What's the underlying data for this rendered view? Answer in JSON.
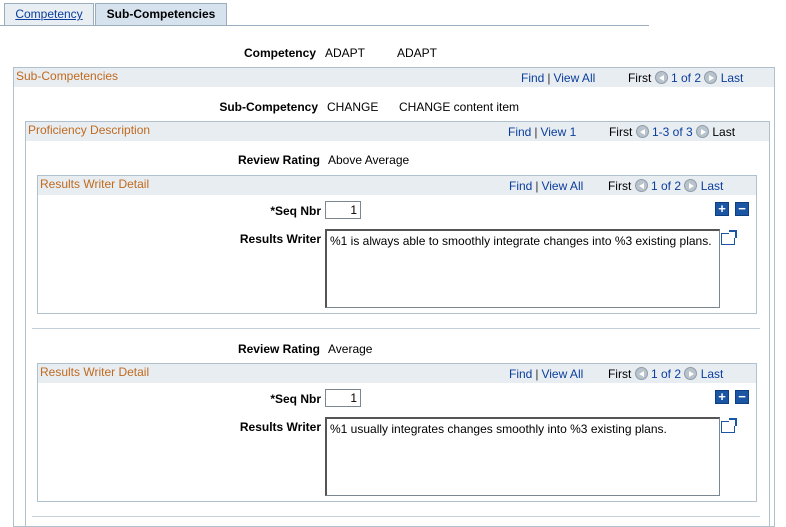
{
  "tabs": [
    {
      "label": "Competency",
      "active": false
    },
    {
      "label": "Sub-Competencies",
      "active": true
    }
  ],
  "competency": {
    "label": "Competency",
    "code": "ADAPT",
    "description": "ADAPT"
  },
  "sub_competencies": {
    "title": "Sub-Competencies",
    "nav": {
      "find": "Find",
      "sep": "|",
      "view": "View All",
      "first": "First",
      "count": "1 of 2",
      "last": "Last"
    },
    "sub_competency": {
      "label": "Sub-Competency",
      "code": "CHANGE",
      "description": "CHANGE content item"
    }
  },
  "proficiency": {
    "title": "Proficiency Description",
    "nav": {
      "find": "Find",
      "sep": "|",
      "view": "View 1",
      "first": "First",
      "count": "1-3 of 3",
      "last": "Last"
    },
    "ratings": [
      {
        "label": "Review Rating",
        "value": "Above Average",
        "writer_detail": {
          "title": "Results Writer Detail",
          "nav": {
            "find": "Find",
            "sep": "|",
            "view": "View All",
            "first": "First",
            "count": "1 of 2",
            "last": "Last"
          },
          "seq_label": "*Seq Nbr",
          "seq_value": "1",
          "writer_label": "Results Writer",
          "writer_text": "%1 is always able to smoothly integrate changes into %3 existing plans."
        }
      },
      {
        "label": "Review Rating",
        "value": "Average",
        "writer_detail": {
          "title": "Results Writer Detail",
          "nav": {
            "find": "Find",
            "sep": "|",
            "view": "View All",
            "first": "First",
            "count": "1 of 2",
            "last": "Last"
          },
          "seq_label": "*Seq Nbr",
          "seq_value": "1",
          "writer_label": "Results Writer",
          "writer_text": "%1 usually integrates changes smoothly into %3 existing plans."
        }
      }
    ]
  },
  "icons": {
    "add": "plus-icon",
    "delete": "minus-icon",
    "expand": "expand-icon",
    "prev": "left-arrow-icon",
    "next": "right-arrow-icon"
  },
  "colors": {
    "link": "#0b3e9c",
    "section_title": "#c06a1e",
    "header_bg": "#e8edf2",
    "button": "#1b56a5"
  }
}
